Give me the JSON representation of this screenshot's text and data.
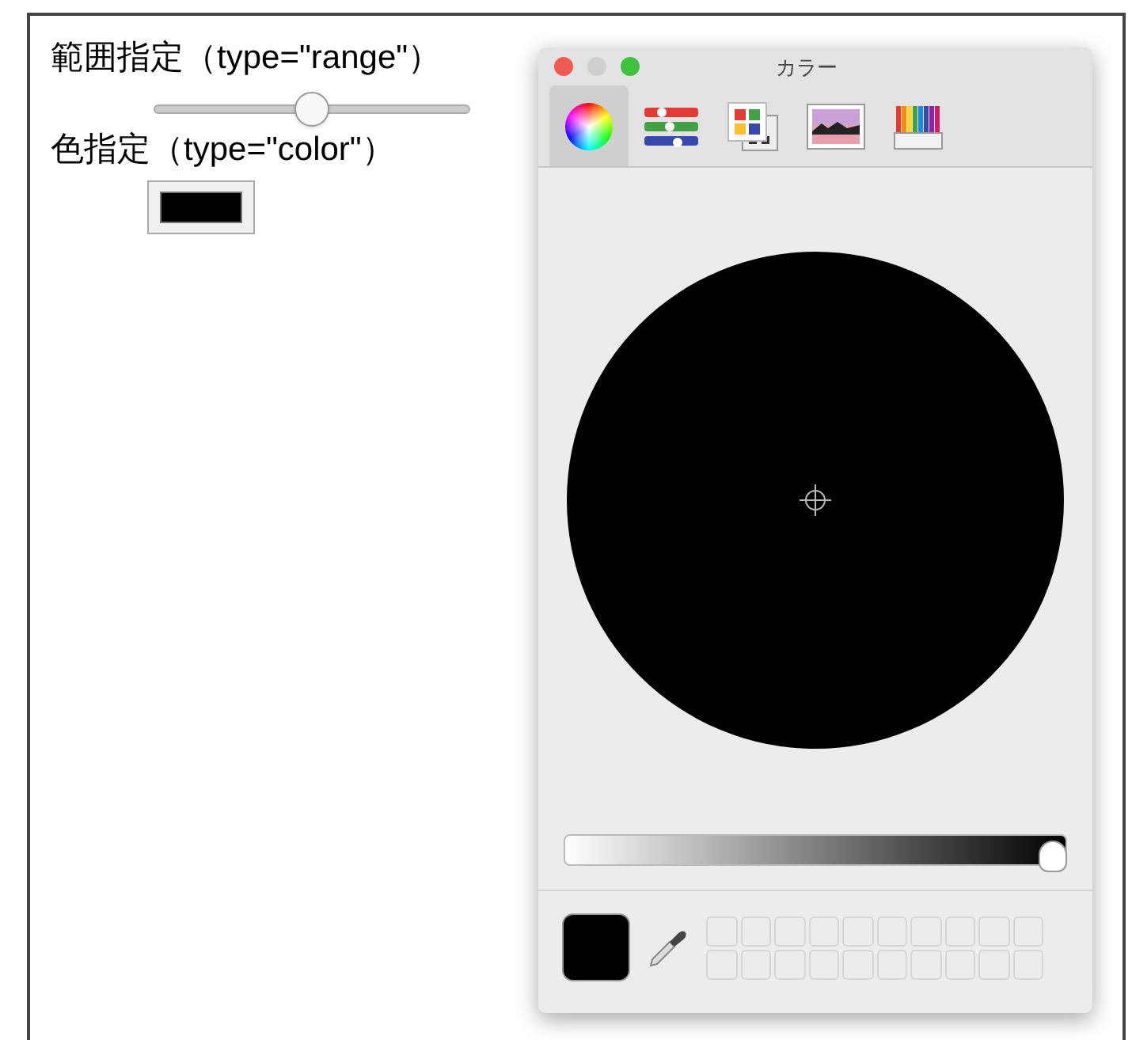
{
  "range_section": {
    "label": "範囲指定（type=\"range\"）",
    "slider": {
      "level": 0.5
    }
  },
  "color_section": {
    "label": "色指定（type=\"color\"）",
    "swatch": {
      "color": "#000000"
    }
  },
  "color_panel": {
    "title": "カラー",
    "tabs": [
      {
        "kind": "wheel",
        "selected": true
      },
      {
        "kind": "sliders",
        "selected": false
      },
      {
        "kind": "palettes",
        "selected": false
      },
      {
        "kind": "image",
        "selected": false
      },
      {
        "kind": "pencils",
        "selected": false
      }
    ],
    "wheel": {
      "color": "#000000"
    },
    "brightness": {
      "level": 1
    },
    "current_color": {
      "color": "#000000"
    }
  }
}
